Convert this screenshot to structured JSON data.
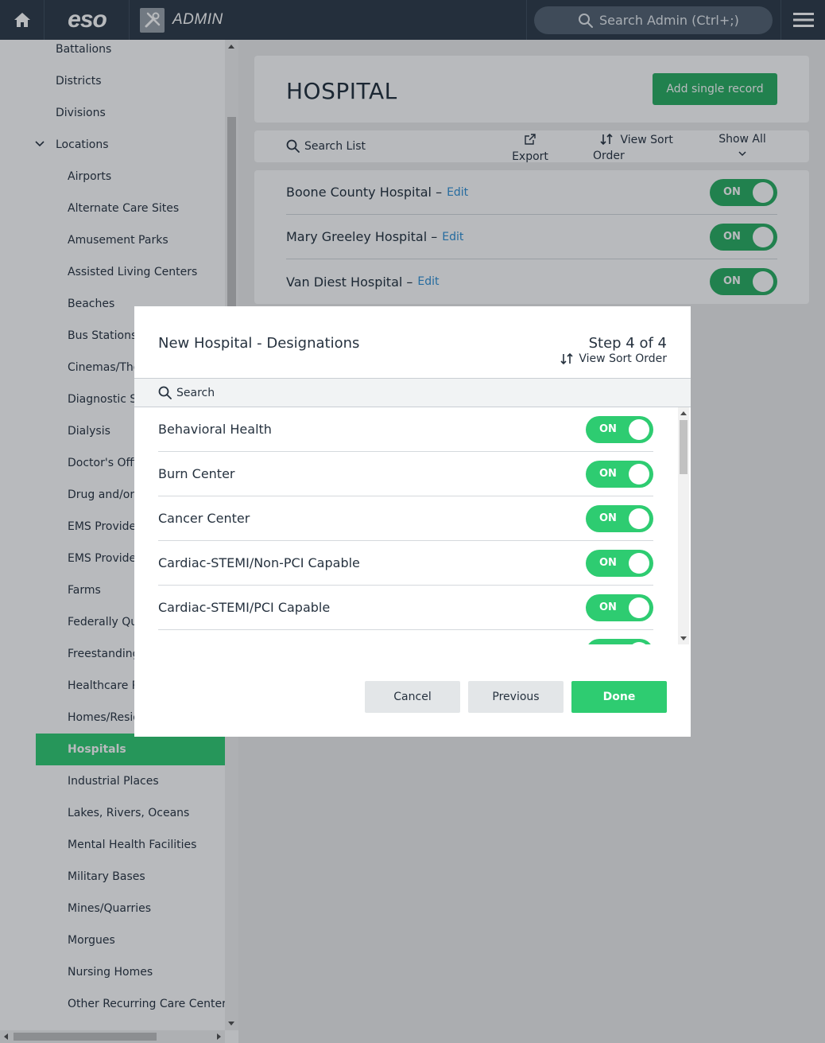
{
  "topbar": {
    "logo": "eso",
    "admin_label": "ADMIN",
    "search_placeholder": "Search Admin (Ctrl+;)"
  },
  "sidebar": {
    "items": [
      {
        "label": "Battalions",
        "level": 1
      },
      {
        "label": "Districts",
        "level": 1
      },
      {
        "label": "Divisions",
        "level": 1
      },
      {
        "label": "Locations",
        "level": 1,
        "expanded": true
      },
      {
        "label": "Airports",
        "level": 2
      },
      {
        "label": "Alternate Care Sites",
        "level": 2
      },
      {
        "label": "Amusement Parks",
        "level": 2
      },
      {
        "label": "Assisted Living Centers",
        "level": 2
      },
      {
        "label": "Beaches",
        "level": 2
      },
      {
        "label": "Bus Stations",
        "level": 2
      },
      {
        "label": "Cinemas/The",
        "level": 2
      },
      {
        "label": "Diagnostic Se",
        "level": 2
      },
      {
        "label": "Dialysis",
        "level": 2
      },
      {
        "label": "Doctor's Offi",
        "level": 2
      },
      {
        "label": "Drug and/or",
        "level": 2
      },
      {
        "label": "EMS Provide",
        "level": 2
      },
      {
        "label": "EMS Provide",
        "level": 2
      },
      {
        "label": "Farms",
        "level": 2
      },
      {
        "label": "Federally Qu",
        "level": 2
      },
      {
        "label": "Freestanding",
        "level": 2
      },
      {
        "label": "Healthcare P",
        "level": 2
      },
      {
        "label": "Homes/Resid",
        "level": 2
      },
      {
        "label": "Hospitals",
        "level": 2,
        "active": true
      },
      {
        "label": "Industrial Places",
        "level": 2
      },
      {
        "label": "Lakes, Rivers, Oceans",
        "level": 2
      },
      {
        "label": "Mental Health Facilities",
        "level": 2
      },
      {
        "label": "Military Bases",
        "level": 2
      },
      {
        "label": "Mines/Quarries",
        "level": 2
      },
      {
        "label": "Morgues",
        "level": 2
      },
      {
        "label": "Nursing Homes",
        "level": 2
      },
      {
        "label": "Other Recurring Care Centers",
        "level": 2
      }
    ]
  },
  "main": {
    "title": "HOSPITAL",
    "add_button": "Add single record",
    "toolbar": {
      "search": "Search List",
      "export": "Export",
      "sort": "View Sort Order",
      "show_all": "Show All"
    },
    "rows": [
      {
        "name": "Boone County Hospital –",
        "edit": "Edit",
        "toggle": "ON"
      },
      {
        "name": "Mary Greeley Hospital –",
        "edit": "Edit",
        "toggle": "ON"
      },
      {
        "name": "Van Diest Hospital –",
        "edit": "Edit",
        "toggle": "ON"
      }
    ]
  },
  "modal": {
    "title": "New Hospital - Designations",
    "step": "Step 4 of 4",
    "sort": "View Sort Order",
    "search": "Search",
    "items": [
      {
        "label": "Behavioral Health",
        "toggle": "ON"
      },
      {
        "label": "Burn Center",
        "toggle": "ON"
      },
      {
        "label": "Cancer Center",
        "toggle": "ON"
      },
      {
        "label": "Cardiac-STEMI/Non-PCI Capable",
        "toggle": "ON"
      },
      {
        "label": "Cardiac-STEMI/PCI Capable",
        "toggle": "ON"
      },
      {
        "label": "",
        "toggle": ""
      }
    ],
    "buttons": {
      "cancel": "Cancel",
      "previous": "Previous",
      "done": "Done"
    }
  },
  "colors": {
    "topbar": "#2b3947",
    "accent_green": "#2ecc71",
    "link_blue": "#2d8fd5"
  }
}
